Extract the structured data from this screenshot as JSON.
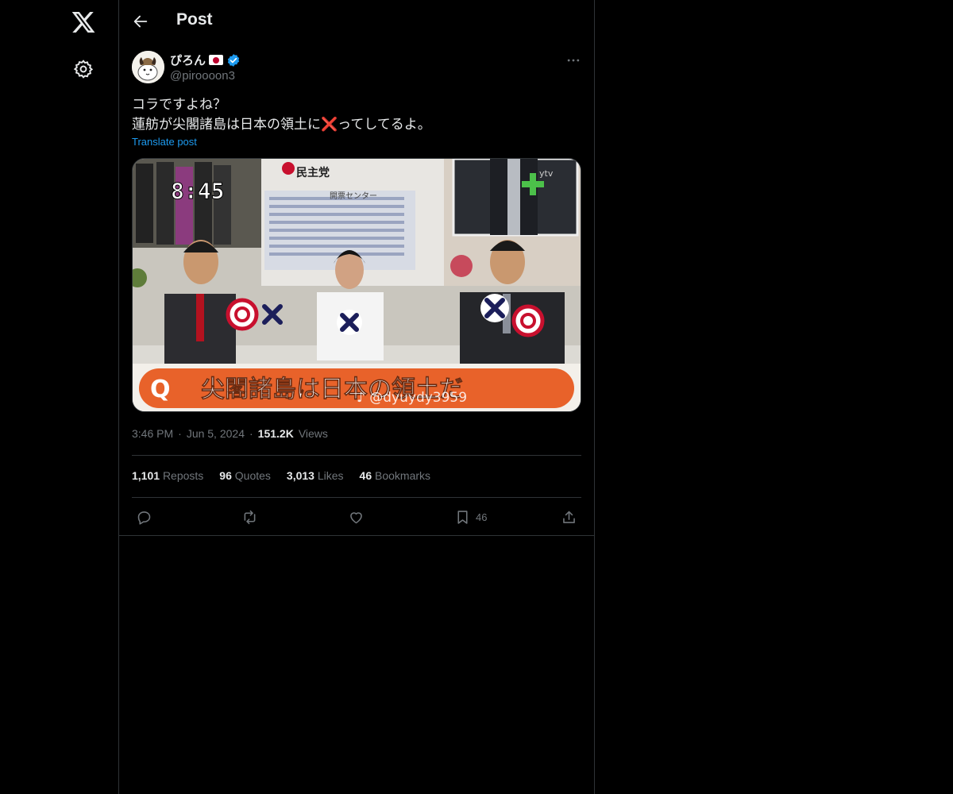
{
  "nav": {
    "logo_icon": "x-logo-icon",
    "settings_icon": "gear-icon"
  },
  "header": {
    "title": "Post",
    "back_icon": "arrow-left-icon"
  },
  "post": {
    "author": {
      "display_name": "ぴろん",
      "handle": "@piroooon3",
      "verified": true
    },
    "text_line1": "コラですよね？",
    "text_line2": "蓮舫が尖閣諸島は日本の領土に❌ってしてるよ。",
    "translate_label": "Translate post",
    "media": {
      "time": "8:45",
      "party_sign": "民主党",
      "center_sign": "開票センター",
      "channel": "ytv",
      "caption_q": "Q",
      "caption": "尖閣諸島は日本の領土だ",
      "watermark": "♪ @dyuydy3959"
    },
    "time": "3:46 PM",
    "date": "Jun 5, 2024",
    "views_count": "151.2K",
    "views_label": "Views",
    "stats": {
      "reposts_count": "1,101",
      "reposts_label": "Reposts",
      "quotes_count": "96",
      "quotes_label": "Quotes",
      "likes_count": "3,013",
      "likes_label": "Likes",
      "bookmarks_count": "46",
      "bookmarks_label": "Bookmarks"
    },
    "actions": {
      "bookmark_count": "46"
    }
  },
  "colors": {
    "background": "#000000",
    "text": "#e7e9ea",
    "secondary": "#71767b",
    "accent": "#1d9bf0",
    "border": "#2f3336"
  }
}
